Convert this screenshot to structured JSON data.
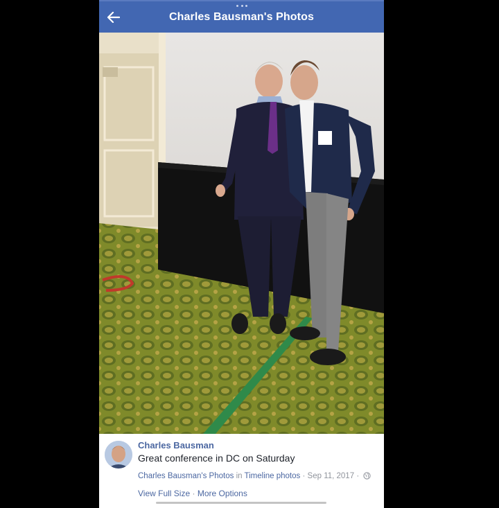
{
  "header": {
    "title": "Charles Bausman's Photos",
    "back_icon": "arrow-left-icon",
    "background": "#4267b2"
  },
  "photo": {
    "description_icon": "photo"
  },
  "post": {
    "author": "Charles Bausman",
    "text": "Great conference in DC on Saturday",
    "album_link": "Charles Bausman's Photos",
    "in_word": "in",
    "timeline_link": "Timeline photos",
    "date": "Sep 11, 2017",
    "privacy_icon": "globe-icon",
    "view_full_size": "View Full Size",
    "more_options": "More Options",
    "link_color": "#4b67a1"
  }
}
